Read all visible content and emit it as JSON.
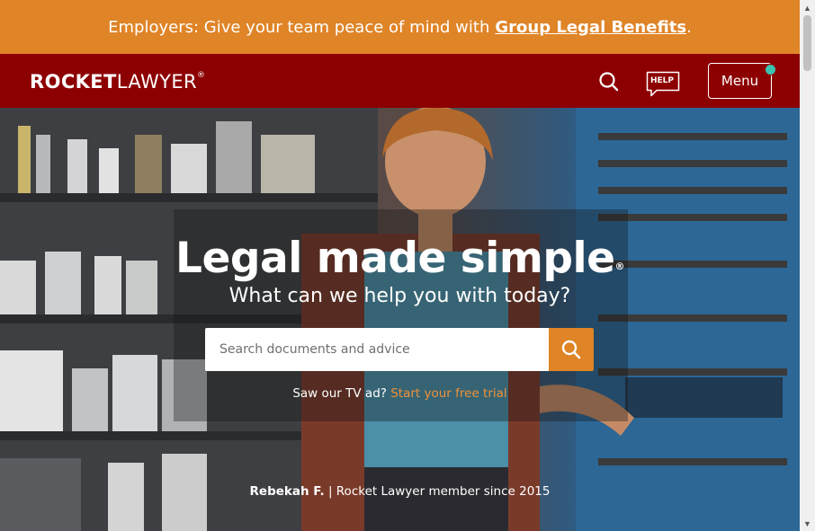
{
  "promo": {
    "text": "Employers: Give your team peace of mind with",
    "link": "Group Legal Benefits",
    "period": "."
  },
  "header": {
    "logo_bold": "ROCKET",
    "logo_light": "LAWYER",
    "logo_mark": "®",
    "search_icon": "search-icon",
    "help_label": "HELP",
    "menu_label": "Menu"
  },
  "hero": {
    "headline": "Legal made simple",
    "headline_mark": "®",
    "subhead": "What can we help you with today?",
    "search_placeholder": "Search documents and advice",
    "tv_prompt": "Saw our TV ad?",
    "tv_link": "Start your free trial",
    "caption_name": "Rebekah F.",
    "caption_rest": " | Rocket Lawyer member since 2015"
  },
  "colors": {
    "promo_bg": "#df8427",
    "header_bg": "#8d0002",
    "accent": "#df8427",
    "notification": "#3cc2b0",
    "link": "#f0923a"
  }
}
